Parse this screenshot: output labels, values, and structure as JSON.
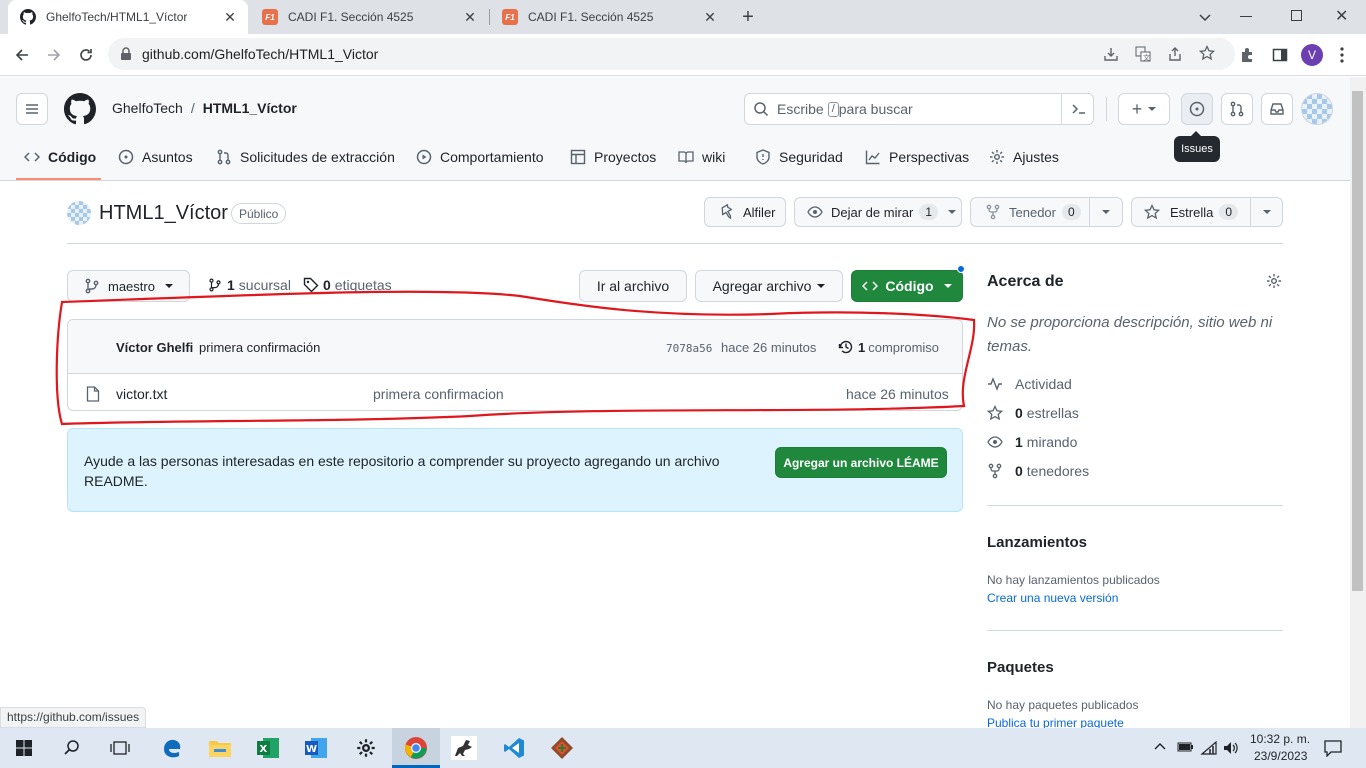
{
  "browser": {
    "tabs": [
      {
        "title": "GhelfoTech/HTML1_Víctor",
        "icon": "github-icon",
        "active": true
      },
      {
        "title": "CADI F1. Sección 4525",
        "icon": "cadi-icon",
        "active": false
      },
      {
        "title": "CADI F1. Sección 4525",
        "icon": "cadi-icon",
        "active": false
      }
    ],
    "url": "github.com/GhelfoTech/HTML1_Victor",
    "profile_initial": "V",
    "status_url": "https://github.com/issues"
  },
  "header": {
    "owner": "GhelfoTech",
    "separator": "/",
    "repo": "HTML1_Víctor",
    "search_before": "Escribe",
    "search_key": "/",
    "search_after": "para buscar",
    "plus": "+",
    "tooltip": "Issues"
  },
  "repo_nav": [
    "Código",
    "Asuntos",
    "Solicitudes de extracción",
    "Comportamiento",
    "Proyectos",
    "wiki",
    "Seguridad",
    "Perspectivas",
    "Ajustes"
  ],
  "repo": {
    "name": "HTML1_Víctor",
    "visibility": "Público",
    "pin_label": "Alfiler",
    "watch_label": "Dejar de mirar",
    "watch_count": "1",
    "fork_label": "Tenedor",
    "fork_count": "0",
    "star_label": "Estrella",
    "star_count": "0"
  },
  "toolbar": {
    "branch": "maestro",
    "branches_count": "1",
    "branches_label": "sucursal",
    "tags_count": "0",
    "tags_label": "etiquetas",
    "goto_file": "Ir al archivo",
    "add_file": "Agregar archivo",
    "code": "Código"
  },
  "commit": {
    "author": "Víctor Ghelfi",
    "message": "primera confirmación",
    "sha": "7078a56",
    "time": "hace 26 minutos",
    "count": "1",
    "count_label": "compromiso"
  },
  "files": [
    {
      "name": "victor.txt",
      "message": "primera confirmacion",
      "time": "hace 26 minutos"
    }
  ],
  "readme_prompt": {
    "text": "Ayude a las personas interesadas en este repositorio a comprender su proyecto agregando un archivo README.",
    "button": "Agregar un archivo LÉAME"
  },
  "about": {
    "title": "Acerca de",
    "description": "No se proporciona descripción, sitio web ni temas.",
    "stats": [
      {
        "icon": "pulse-icon",
        "count": "",
        "label": "Actividad"
      },
      {
        "icon": "star-icon",
        "count": "0",
        "label": "estrellas"
      },
      {
        "icon": "eye-icon",
        "count": "1",
        "label": "mirando"
      },
      {
        "icon": "fork-icon",
        "count": "0",
        "label": "tenedores"
      }
    ]
  },
  "releases": {
    "title": "Lanzamientos",
    "empty": "No hay lanzamientos publicados",
    "link": "Crear una nueva versión"
  },
  "packages": {
    "title": "Paquetes",
    "empty": "No hay paquetes publicados",
    "link": "Publica tu primer paquete"
  },
  "taskbar": {
    "time": "10:32 p. m.",
    "date": "23/9/2023"
  },
  "colors": {
    "green": "#1f883d",
    "link": "#0969da",
    "annotation": "#e0171c",
    "readme_bg": "#ddf4ff"
  }
}
